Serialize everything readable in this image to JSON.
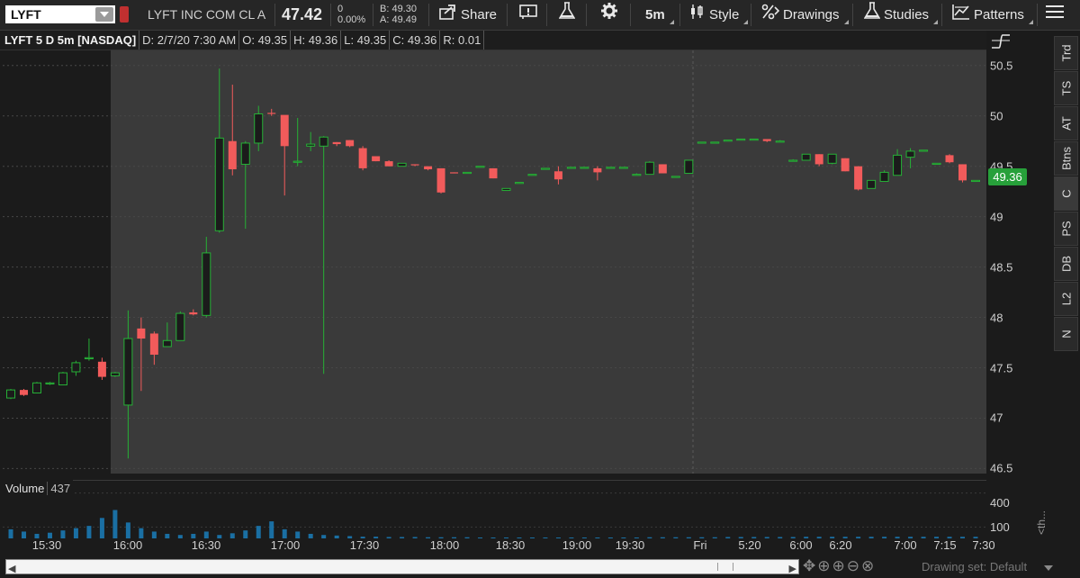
{
  "toolbar": {
    "symbol": "LYFT",
    "company": "LYFT INC COM CL A",
    "last_price": "47.42",
    "net_change": "0",
    "pct_change": "0.00%",
    "bid": "B: 49.30",
    "ask": "A: 49.49",
    "share_label": "Share",
    "timeframe_label": "5m",
    "style_label": "Style",
    "drawings_label": "Drawings",
    "studies_label": "Studies",
    "patterns_label": "Patterns"
  },
  "infobar": {
    "title": "LYFT 5 D 5m [NASDAQ]",
    "date": "D: 2/7/20 7:30 AM",
    "open": "O: 49.35",
    "high": "H: 49.36",
    "low": "L: 49.35",
    "close": "C: 49.36",
    "range": "R: 0.01"
  },
  "price_axis": {
    "ticks": [
      "50.5",
      "50",
      "49.5",
      "49",
      "48.5",
      "48",
      "47.5",
      "47",
      "46.5"
    ],
    "current": "49.36"
  },
  "volume": {
    "label": "Volume",
    "value": "437",
    "ticks": [
      "400",
      "100"
    ],
    "side_text": "<th..."
  },
  "time_axis": {
    "ticks": [
      "15:30",
      "16:00",
      "16:30",
      "17:00",
      "17:30",
      "18:00",
      "18:30",
      "19:00",
      "19:30",
      "Fri",
      "5:20",
      "6:00",
      "6:20",
      "7:00",
      "7:15",
      "7:30"
    ]
  },
  "side_tabs": [
    "Trd",
    "TS",
    "AT",
    "Btns",
    "C",
    "PS",
    "DB",
    "L2",
    "N"
  ],
  "status": {
    "drawing_set": "Drawing set: Default"
  },
  "colors": {
    "up": "#26b036",
    "down": "#f25b5b",
    "background": "#1b1b1b",
    "session": "#3a3a3a",
    "label": "#27a03a"
  },
  "chart_data": {
    "type": "candlestick",
    "ylim": [
      46.45,
      50.65
    ],
    "up_color": "#26b036",
    "down_color": "#f25b5b",
    "candles": [
      {
        "o": 47.2,
        "h": 47.29,
        "l": 47.19,
        "c": 47.28
      },
      {
        "o": 47.28,
        "h": 47.29,
        "l": 47.22,
        "c": 47.23
      },
      {
        "o": 47.25,
        "h": 47.36,
        "l": 47.25,
        "c": 47.35
      },
      {
        "o": 47.35,
        "h": 47.36,
        "l": 47.33,
        "c": 47.35
      },
      {
        "o": 47.33,
        "h": 47.46,
        "l": 47.33,
        "c": 47.45
      },
      {
        "o": 47.46,
        "h": 47.57,
        "l": 47.42,
        "c": 47.55
      },
      {
        "o": 47.6,
        "h": 47.79,
        "l": 47.57,
        "c": 47.6
      },
      {
        "o": 47.56,
        "h": 47.6,
        "l": 47.38,
        "c": 47.41
      },
      {
        "o": 47.42,
        "h": 47.46,
        "l": 47.41,
        "c": 47.45
      },
      {
        "o": 47.13,
        "h": 48.07,
        "l": 46.6,
        "c": 47.79
      },
      {
        "o": 47.89,
        "h": 48.0,
        "l": 47.27,
        "c": 47.79
      },
      {
        "o": 47.84,
        "h": 47.86,
        "l": 47.53,
        "c": 47.63
      },
      {
        "o": 47.71,
        "h": 47.95,
        "l": 47.71,
        "c": 47.77
      },
      {
        "o": 47.77,
        "h": 48.06,
        "l": 47.77,
        "c": 48.04
      },
      {
        "o": 48.05,
        "h": 48.08,
        "l": 48.02,
        "c": 48.03
      },
      {
        "o": 48.02,
        "h": 48.8,
        "l": 48.0,
        "c": 48.64
      },
      {
        "o": 48.86,
        "h": 50.47,
        "l": 48.84,
        "c": 49.78
      },
      {
        "o": 49.75,
        "h": 50.31,
        "l": 49.41,
        "c": 49.47
      },
      {
        "o": 49.52,
        "h": 49.75,
        "l": 48.88,
        "c": 49.73
      },
      {
        "o": 49.73,
        "h": 50.1,
        "l": 49.65,
        "c": 50.02
      },
      {
        "o": 50.03,
        "h": 50.07,
        "l": 50.0,
        "c": 50.02
      },
      {
        "o": 50.01,
        "h": 50.0,
        "l": 49.21,
        "c": 49.7
      },
      {
        "o": 49.54,
        "h": 49.98,
        "l": 49.5,
        "c": 49.55
      },
      {
        "o": 49.7,
        "h": 49.84,
        "l": 49.65,
        "c": 49.72
      },
      {
        "o": 49.7,
        "h": 49.8,
        "l": 47.44,
        "c": 49.79
      },
      {
        "o": 49.74,
        "h": 49.74,
        "l": 49.7,
        "c": 49.72
      },
      {
        "o": 49.76,
        "h": 49.76,
        "l": 49.69,
        "c": 49.7
      },
      {
        "o": 49.68,
        "h": 49.7,
        "l": 49.46,
        "c": 49.48
      },
      {
        "o": 49.6,
        "h": 49.6,
        "l": 49.55,
        "c": 49.55
      },
      {
        "o": 49.55,
        "h": 49.56,
        "l": 49.5,
        "c": 49.5
      },
      {
        "o": 49.5,
        "h": 49.53,
        "l": 49.5,
        "c": 49.53
      },
      {
        "o": 49.52,
        "h": 49.52,
        "l": 49.5,
        "c": 49.51
      },
      {
        "o": 49.5,
        "h": 49.5,
        "l": 49.46,
        "c": 49.47
      },
      {
        "o": 49.48,
        "h": 49.48,
        "l": 49.23,
        "c": 49.24
      },
      {
        "o": 49.44,
        "h": 49.44,
        "l": 49.43,
        "c": 49.43
      },
      {
        "o": 49.44,
        "h": 49.44,
        "l": 49.44,
        "c": 49.44
      },
      {
        "o": 49.5,
        "h": 49.5,
        "l": 49.5,
        "c": 49.5
      },
      {
        "o": 49.48,
        "h": 49.48,
        "l": 49.38,
        "c": 49.38
      },
      {
        "o": 49.26,
        "h": 49.28,
        "l": 49.26,
        "c": 49.28
      },
      {
        "o": 49.34,
        "h": 49.34,
        "l": 49.33,
        "c": 49.34
      },
      {
        "o": 49.42,
        "h": 49.42,
        "l": 49.42,
        "c": 49.42
      },
      {
        "o": 49.48,
        "h": 49.48,
        "l": 49.48,
        "c": 49.48
      },
      {
        "o": 49.45,
        "h": 49.5,
        "l": 49.32,
        "c": 49.37
      },
      {
        "o": 49.49,
        "h": 49.49,
        "l": 49.48,
        "c": 49.49
      },
      {
        "o": 49.49,
        "h": 49.49,
        "l": 49.49,
        "c": 49.49
      },
      {
        "o": 49.48,
        "h": 49.5,
        "l": 49.36,
        "c": 49.44
      },
      {
        "o": 49.49,
        "h": 49.49,
        "l": 49.49,
        "c": 49.49
      },
      {
        "o": 49.48,
        "h": 49.49,
        "l": 49.48,
        "c": 49.49
      },
      {
        "o": 49.41,
        "h": 49.43,
        "l": 49.41,
        "c": 49.42
      },
      {
        "o": 49.42,
        "h": 49.55,
        "l": 49.42,
        "c": 49.54
      },
      {
        "o": 49.52,
        "h": 49.52,
        "l": 49.43,
        "c": 49.43
      },
      {
        "o": 49.39,
        "h": 49.4,
        "l": 49.39,
        "c": 49.4
      },
      {
        "o": 49.43,
        "h": 49.56,
        "l": 49.43,
        "c": 49.56
      },
      {
        "o": 49.74,
        "h": 49.74,
        "l": 49.74,
        "c": 49.74
      },
      {
        "o": 49.74,
        "h": 49.74,
        "l": 49.74,
        "c": 49.74
      },
      {
        "o": 49.76,
        "h": 49.76,
        "l": 49.76,
        "c": 49.76
      },
      {
        "o": 49.77,
        "h": 49.77,
        "l": 49.77,
        "c": 49.77
      },
      {
        "o": 49.77,
        "h": 49.77,
        "l": 49.77,
        "c": 49.77
      },
      {
        "o": 49.77,
        "h": 49.77,
        "l": 49.74,
        "c": 49.75
      },
      {
        "o": 49.74,
        "h": 49.76,
        "l": 49.74,
        "c": 49.75
      },
      {
        "o": 49.56,
        "h": 49.57,
        "l": 49.55,
        "c": 49.56
      },
      {
        "o": 49.56,
        "h": 49.62,
        "l": 49.56,
        "c": 49.62
      },
      {
        "o": 49.62,
        "h": 49.62,
        "l": 49.5,
        "c": 49.52
      },
      {
        "o": 49.53,
        "h": 49.62,
        "l": 49.52,
        "c": 49.62
      },
      {
        "o": 49.58,
        "h": 49.58,
        "l": 49.45,
        "c": 49.45
      },
      {
        "o": 49.5,
        "h": 49.5,
        "l": 49.26,
        "c": 49.27
      },
      {
        "o": 49.28,
        "h": 49.36,
        "l": 49.28,
        "c": 49.36
      },
      {
        "o": 49.35,
        "h": 49.46,
        "l": 49.35,
        "c": 49.44
      },
      {
        "o": 49.41,
        "h": 49.67,
        "l": 49.41,
        "c": 49.61
      },
      {
        "o": 49.59,
        "h": 49.68,
        "l": 49.48,
        "c": 49.65
      },
      {
        "o": 49.66,
        "h": 49.66,
        "l": 49.66,
        "c": 49.66
      },
      {
        "o": 49.53,
        "h": 49.53,
        "l": 49.53,
        "c": 49.53
      },
      {
        "o": 49.61,
        "h": 49.62,
        "l": 49.53,
        "c": 49.54
      },
      {
        "o": 49.52,
        "h": 49.52,
        "l": 49.34,
        "c": 49.36
      },
      {
        "o": 49.36,
        "h": 49.36,
        "l": 49.35,
        "c": 49.36
      }
    ],
    "volume": [
      80,
      60,
      40,
      50,
      70,
      90,
      110,
      180,
      250,
      140,
      90,
      60,
      40,
      30,
      40,
      60,
      30,
      45,
      70,
      110,
      150,
      80,
      60,
      40,
      30,
      25,
      20,
      15,
      15,
      12,
      12,
      12,
      10,
      10,
      10,
      10,
      8,
      8,
      8,
      8,
      8,
      8,
      8,
      8,
      8,
      8,
      8,
      8,
      8,
      10,
      10,
      10,
      10,
      10,
      10,
      12,
      12,
      12,
      12,
      12,
      12,
      14,
      14,
      14,
      14,
      14,
      14,
      14,
      14,
      14,
      14,
      14,
      14,
      14,
      14
    ],
    "volume_max": 460
  }
}
